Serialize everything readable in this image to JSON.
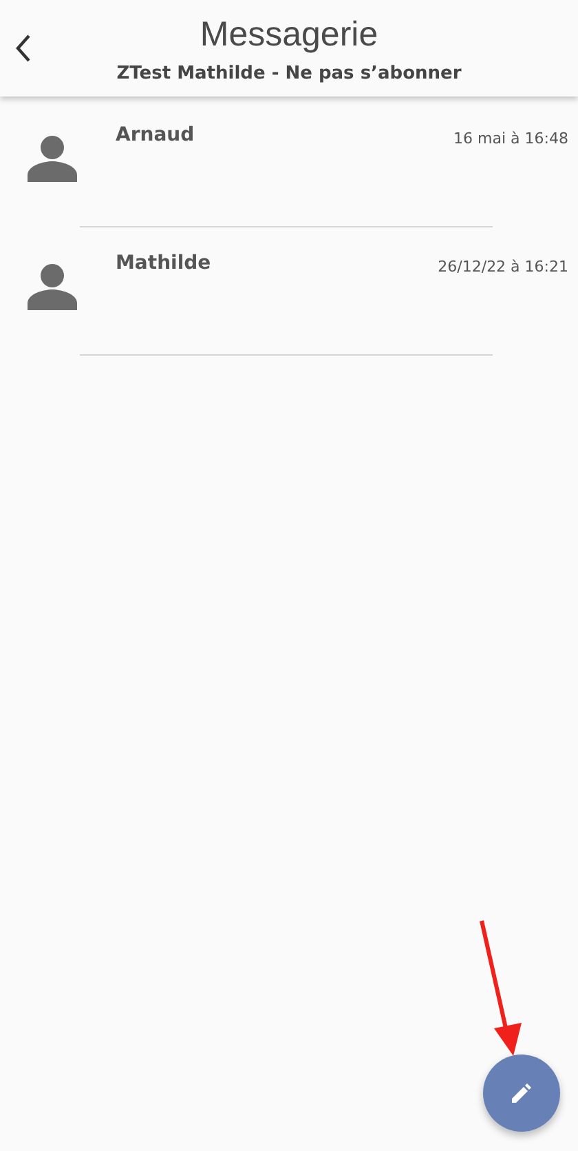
{
  "header": {
    "title": "Messagerie",
    "subtitle": "ZTest Mathilde - Ne pas s’abonner"
  },
  "conversations": [
    {
      "name": "Arnaud",
      "time": "16 mai à 16:48"
    },
    {
      "name": "Mathilde",
      "time": "26/12/22 à 16:21"
    }
  ],
  "annotation": {
    "kind": "arrow"
  }
}
